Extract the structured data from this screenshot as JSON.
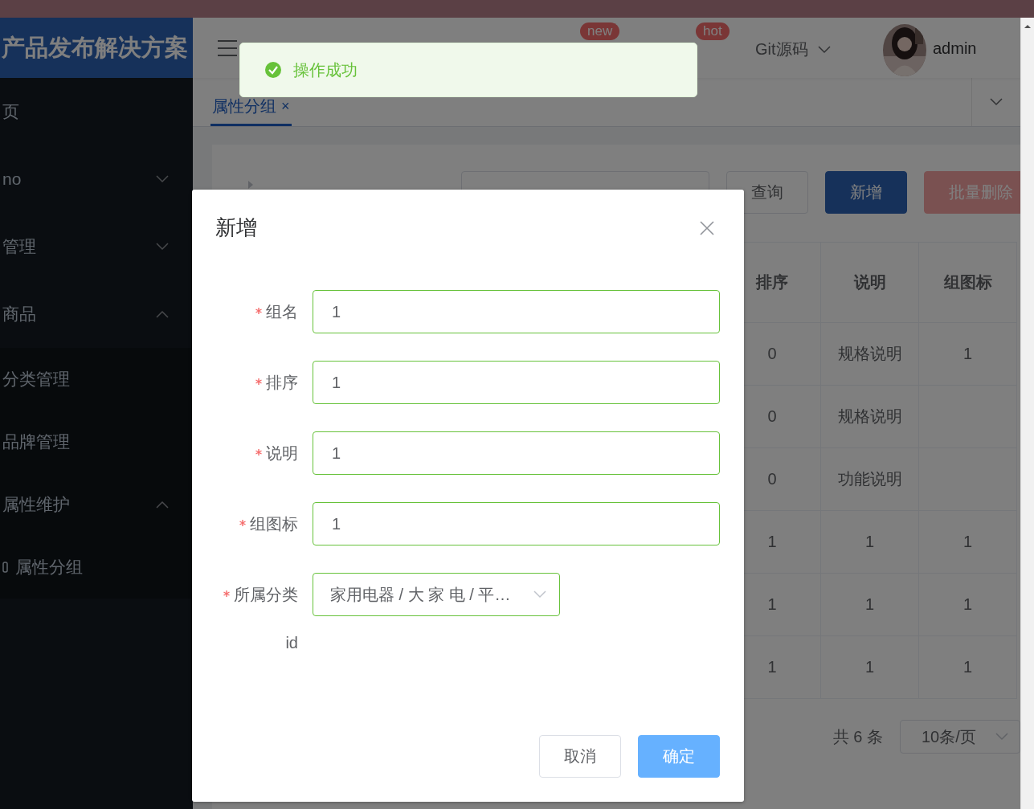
{
  "sidebar": {
    "logo": "产品发布解决方案",
    "items": [
      {
        "label": "页",
        "kind": "item"
      },
      {
        "label": "no",
        "kind": "submenu",
        "expanded": false
      },
      {
        "label": "管理",
        "kind": "submenu",
        "expanded": false
      },
      {
        "label": "商品",
        "kind": "submenu",
        "expanded": true,
        "children": [
          {
            "label": "分类管理",
            "kind": "item"
          },
          {
            "label": "品牌管理",
            "kind": "item"
          },
          {
            "label": "属性维护",
            "kind": "submenu",
            "expanded": true,
            "children": [
              {
                "label": "属性分组",
                "kind": "item"
              }
            ]
          }
        ]
      }
    ]
  },
  "header": {
    "badges": [
      {
        "text": "new"
      },
      {
        "text": "hot"
      }
    ],
    "git": "Git源码",
    "user": "admin"
  },
  "tabs": [
    {
      "label": "属性分组",
      "close": "×",
      "selected": true
    }
  ],
  "toolbar": {
    "buttons": [
      {
        "label": "查询",
        "kind": "default"
      },
      {
        "label": "新增",
        "kind": "primary"
      },
      {
        "label": "批量删除",
        "kind": "danger"
      }
    ]
  },
  "table": {
    "columns": [
      "排序",
      "说明",
      "组图标"
    ],
    "rows": [
      {
        "sort": "0",
        "description": "规格说明",
        "icon": "1"
      },
      {
        "sort": "0",
        "description": "规格说明"
      },
      {
        "sort": "0",
        "description": "功能说明"
      },
      {
        "sort": "1",
        "description": "1",
        "icon": "1"
      },
      {
        "sort": "1",
        "description": "1",
        "icon": "1"
      },
      {
        "sort": "1",
        "description": "1",
        "icon": "1"
      }
    ]
  },
  "pagination": {
    "total": "共 6 条",
    "page_size": "10条/页"
  },
  "toast": {
    "kind": "success",
    "text": "操作成功"
  },
  "dialog": {
    "title": "新增",
    "fields": [
      {
        "label": "组名",
        "required": true,
        "kind": "input",
        "value": "1",
        "valid": true
      },
      {
        "label": "排序",
        "required": true,
        "kind": "input",
        "value": "1",
        "valid": true
      },
      {
        "label": "说明",
        "required": true,
        "kind": "input",
        "value": "1",
        "valid": true
      },
      {
        "label": "组图标",
        "required": true,
        "kind": "input",
        "value": "1",
        "valid": true
      },
      {
        "label": "所属分类",
        "required": true,
        "kind": "cascader",
        "value": "家用电器 / 大 家 电 / 平…",
        "valid": true
      },
      {
        "label": "id",
        "required": false,
        "kind": "text"
      }
    ],
    "buttons": [
      {
        "label": "取消",
        "kind": "default"
      },
      {
        "label": "确定",
        "kind": "primary"
      }
    ]
  }
}
